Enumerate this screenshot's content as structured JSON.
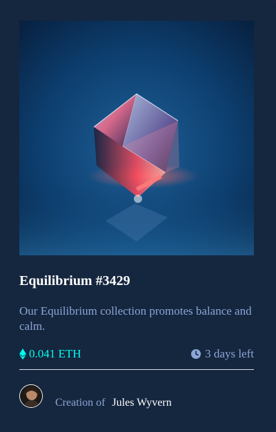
{
  "card": {
    "title": "Equilibrium #3429",
    "description": "Our Equilibrium collection promotes balance and calm.",
    "price": "0.041 ETH",
    "time_left": "3 days left",
    "creator_prefix": "Creation of",
    "creator_name": "Jules Wyvern"
  },
  "icons": {
    "price": "ethereum-icon",
    "time": "clock-icon"
  },
  "colors": {
    "card_background": "#15263f",
    "page_background": "#1a2640",
    "accent_cyan": "#00fff0",
    "soft_blue": "#8ba6d6",
    "white": "#ffffff"
  }
}
